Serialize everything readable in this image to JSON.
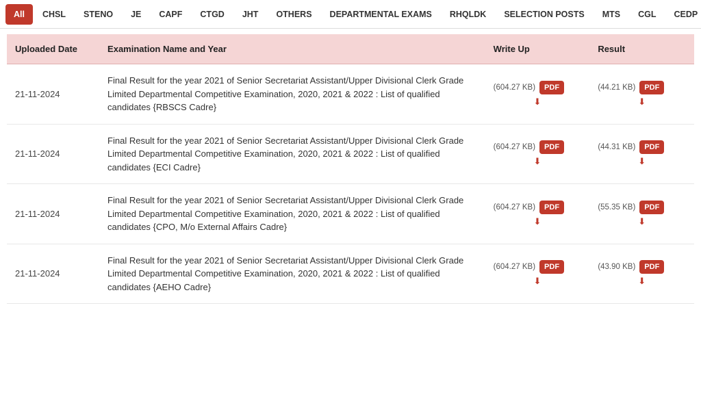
{
  "tabs": [
    {
      "id": "all",
      "label": "All",
      "active": true
    },
    {
      "id": "chsl",
      "label": "CHSL",
      "active": false
    },
    {
      "id": "steno",
      "label": "STENO",
      "active": false
    },
    {
      "id": "je",
      "label": "JE",
      "active": false
    },
    {
      "id": "capf",
      "label": "CAPF",
      "active": false
    },
    {
      "id": "ctgd",
      "label": "CTGD",
      "active": false
    },
    {
      "id": "jht",
      "label": "JHT",
      "active": false
    },
    {
      "id": "others",
      "label": "OTHERS",
      "active": false
    },
    {
      "id": "departmental",
      "label": "DEPARTMENTAL EXAMS",
      "active": false
    },
    {
      "id": "rhqldk",
      "label": "RHQLDK",
      "active": false
    },
    {
      "id": "selection",
      "label": "SELECTION POSTS",
      "active": false
    },
    {
      "id": "mts",
      "label": "MTS",
      "active": false
    },
    {
      "id": "cgl",
      "label": "CGL",
      "active": false
    },
    {
      "id": "cedp",
      "label": "CEDP",
      "active": false
    }
  ],
  "table": {
    "columns": {
      "date": "Uploaded Date",
      "name": "Examination Name and Year",
      "writeup": "Write Up",
      "result": "Result"
    },
    "rows": [
      {
        "date": "21-11-2024",
        "exam_name": "Final Result for the year 2021 of Senior Secretariat Assistant/Upper Divisional Clerk Grade Limited Departmental Competitive Examination, 2020, 2021 & 2022 : List of qualified candidates {RBSCS Cadre}",
        "writeup_size": "(604.27 KB)",
        "result_size": "(44.21 KB)"
      },
      {
        "date": "21-11-2024",
        "exam_name": "Final Result for the year 2021 of Senior Secretariat Assistant/Upper Divisional Clerk Grade Limited Departmental Competitive Examination, 2020, 2021 & 2022 : List of qualified candidates {ECI Cadre}",
        "writeup_size": "(604.27 KB)",
        "result_size": "(44.31 KB)"
      },
      {
        "date": "21-11-2024",
        "exam_name": "Final Result for the year 2021 of Senior Secretariat Assistant/Upper Divisional Clerk Grade Limited Departmental Competitive Examination, 2020, 2021 & 2022 : List of qualified candidates {CPO, M/o External Affairs Cadre}",
        "writeup_size": "(604.27 KB)",
        "result_size": "(55.35 KB)"
      },
      {
        "date": "21-11-2024",
        "exam_name": "Final Result for the year 2021 of Senior Secretariat Assistant/Upper Divisional Clerk Grade Limited Departmental Competitive Examination, 2020, 2021 & 2022 : List of qualified candidates {AEHO Cadre}",
        "writeup_size": "(604.27 KB)",
        "result_size": "(43.90 KB)"
      }
    ]
  }
}
